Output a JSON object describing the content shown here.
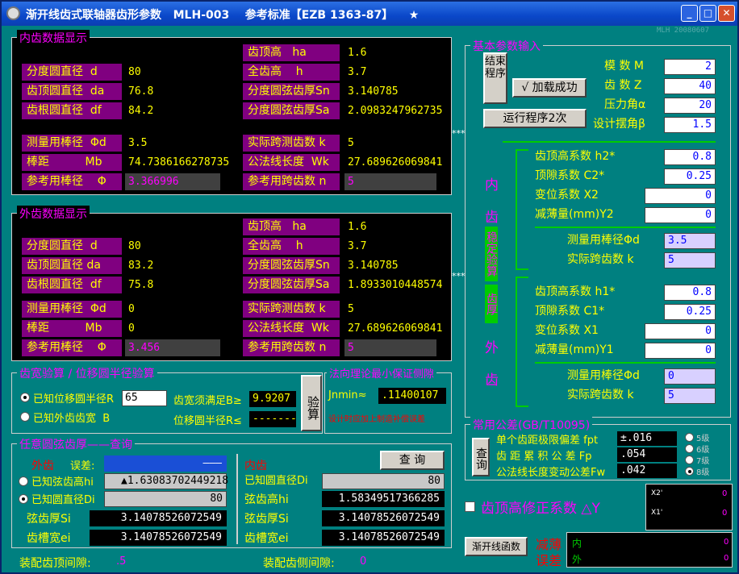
{
  "title": "渐开线齿式联轴器齿形参数   MLH-003    参考标准【EZB 1363-87】    ★",
  "version_tag": "MLH 20080607",
  "inner_display": {
    "title": "内齿数据显示",
    "left": [
      {
        "label": "分度圆直径  d",
        "value": "80"
      },
      {
        "label": "齿顶圆直径  da",
        "value": "76.8"
      },
      {
        "label": "齿根圆直径  df",
        "value": "84.2"
      },
      {
        "label": "测量用棒径  Φd",
        "value": "3.5"
      },
      {
        "label": "棒距          Mb",
        "value": "74.7386166278735"
      },
      {
        "label": "参考用棒径    Φ",
        "value": "3.366996"
      }
    ],
    "right": [
      {
        "label": "齿顶高   ha",
        "value": "1.6"
      },
      {
        "label": "全齿高    h",
        "value": "3.7"
      },
      {
        "label": "分度圆弦齿厚Sn",
        "value": "3.140785"
      },
      {
        "label": "分度圆弦齿厚Sa",
        "value": "2.0983247962735"
      },
      {
        "label": "实际跨测齿数 k",
        "value": "5"
      },
      {
        "label": "公法线长度  Wk",
        "value": "27.689626069841"
      },
      {
        "label": "参考用跨齿数 n",
        "value": "5"
      }
    ]
  },
  "outer_display": {
    "title": "外齿数据显示",
    "left": [
      {
        "label": "分度圆直径  d",
        "value": "80"
      },
      {
        "label": "齿顶圆直径 da",
        "value": "83.2"
      },
      {
        "label": "齿根圆直径  df",
        "value": "75.8"
      },
      {
        "label": "测量用棒径  Φd",
        "value": "0"
      },
      {
        "label": "棒距          Mb",
        "value": "0"
      },
      {
        "label": "参考用棒径    Φ",
        "value": "3.456"
      }
    ],
    "right": [
      {
        "label": "齿顶高   ha",
        "value": "1.6"
      },
      {
        "label": "全齿高    h",
        "value": "3.7"
      },
      {
        "label": "分度圆弦齿厚Sn",
        "value": "3.140785"
      },
      {
        "label": "分度圆弦齿厚Sa",
        "value": "1.8933010448574"
      },
      {
        "label": "实际跨测齿数 k",
        "value": "5"
      },
      {
        "label": "公法线长度  Wk",
        "value": "27.689626069841"
      },
      {
        "label": "参考用跨齿数 n",
        "value": "5"
      }
    ]
  },
  "stars": "***",
  "basic": {
    "title": "基本参数输入",
    "end_btn": "结束程序",
    "load_btn": "√ 加载成功",
    "run_btn": "运行程序2次",
    "modulus_label": "模 数 M",
    "modulus": "2",
    "teeth_label": "齿 数 Z",
    "teeth": "40",
    "pressure_label": "压力角α",
    "pressure": "20",
    "swing_label": "设计摆角β",
    "swing": "1.5"
  },
  "inner_side": {
    "char1": "内",
    "char2": "齿",
    "verify1": "稳定验算",
    "verify2": "齿厚",
    "h2_label": "齿顶高系数 h2*",
    "h2": "0.8",
    "c2_label": "顶隙系数 C2*",
    "c2": "0.25",
    "x2_label": "变位系数 X2",
    "x2": "0",
    "y2_label": "减薄量(mm)Y2",
    "y2": "0",
    "phid_label": "测量用棒径Φd",
    "phid": "3.5",
    "k_label": "实际跨齿数 k",
    "k": "5"
  },
  "outer_side": {
    "char1": "外",
    "char2": "齿",
    "h1_label": "齿顶高系数 h1*",
    "h1": "0.8",
    "c1_label": "顶隙系数 C1*",
    "c1": "0.25",
    "x1_label": "变位系数 X1",
    "x1": "0",
    "y1_label": "减薄量(mm)Y1",
    "y1": "0",
    "phid_label": "测量用棒径Φd",
    "phid": "0",
    "k_label": "实际跨齿数 k",
    "k": "5"
  },
  "tooth_width": {
    "title": "齿宽验算 / 位移圆半径验算",
    "opt1": "已知位移圆半径R",
    "r_value": "65",
    "opt2": "已知外齿齿宽  B",
    "cond1": "齿宽须满足B≥",
    "cond1_val": "9.9207",
    "cond2": "位移圆半径R≤",
    "cond2_val": "-------",
    "btn": "验算"
  },
  "normal": {
    "title": "法向理论最小保证侧隙",
    "jn_label": "Jnmin≈",
    "jn_value": ".11400107",
    "note": "设计时应加上制造补偿误差"
  },
  "arc": {
    "title": "任意圆弦齿厚——查询",
    "outer": "外齿",
    "error_label": "误差:",
    "error_val": "———",
    "opt1": "已知弦齿高hi",
    "hi_val": "▲1.63083702449218",
    "opt2": "已知圆直径Di",
    "di_val": "80",
    "si_label": "弦齿厚Si",
    "si_val": "3.14078526072549",
    "ei_label": "齿槽宽ei",
    "ei_val": "3.14078526072549",
    "inner": "内齿",
    "query_btn": "查  询",
    "in_di_label": "已知圆直径Di",
    "in_di_val": "80",
    "in_hi_label": "弦齿高hi",
    "in_hi_val": "1.58349517366285",
    "in_si_label": "弦齿厚Si",
    "in_si_val": "3.14078526072549",
    "in_ei_label": "齿槽宽ei",
    "in_ei_val": "3.14078526072549"
  },
  "tolerance": {
    "title": "常用公差(GB/T10095)",
    "query_btn": "查询",
    "fpt_label": "单个齿距极限偏差 fpt",
    "fpt": "±.016",
    "fp_label": "齿 距 累 积 公 差 Fp",
    "fp": ".054",
    "fw_label": "公法线长度变动公差Fw",
    "fw": ".042",
    "grades": [
      "5级",
      "6级",
      "7级",
      "8级"
    ],
    "selected_grade": "8级"
  },
  "correction": {
    "label": "齿顶高修正系数 △Y"
  },
  "x2prime": {
    "label": "X2'",
    "value": "0"
  },
  "x1prime": {
    "label": "X1'",
    "value": "0"
  },
  "involute_btn": "渐开线函数",
  "thin": {
    "label1": "减薄",
    "label2": "误差",
    "inner": "内",
    "outer": "外",
    "inner_val": "0",
    "outer_val": "0"
  },
  "bottom": {
    "top_clear_label": "装配齿顶间隙:",
    "top_clear": ".5",
    "side_clear_label": "装配齿侧间隙:",
    "side_clear": "0"
  }
}
